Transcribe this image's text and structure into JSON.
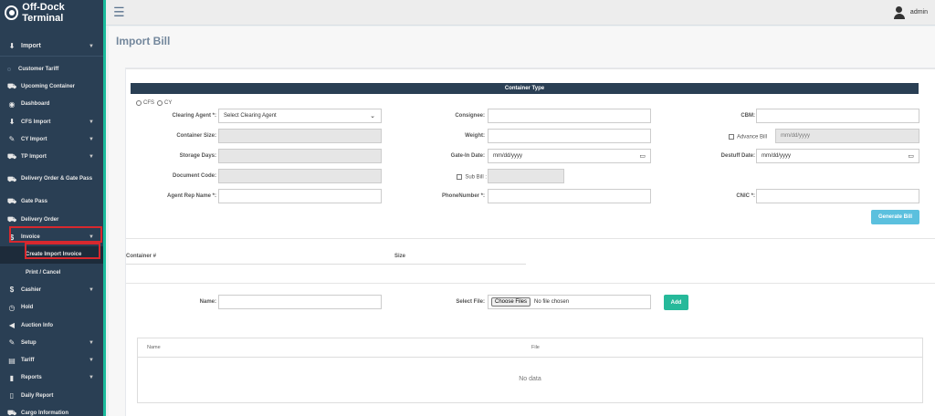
{
  "app": {
    "title": "Off-Dock Terminal"
  },
  "topbar": {
    "user": "admin"
  },
  "sidebar": {
    "top": {
      "label": "Import",
      "icon": "import-icon"
    },
    "items": [
      {
        "label": "Customer Tariff",
        "icon": "dot",
        "name": "customer-tariff"
      },
      {
        "label": "Upcoming Container",
        "icon": "bus-icon",
        "name": "upcoming-container"
      },
      {
        "label": "Dashboard",
        "icon": "dashboard-icon",
        "name": "dashboard"
      },
      {
        "label": "CFS Import",
        "icon": "import-icon",
        "name": "cfs-import",
        "chevron": true
      },
      {
        "label": "CY Import",
        "icon": "edit-icon",
        "name": "cy-import",
        "chevron": true
      },
      {
        "label": "TP Import",
        "icon": "truck-icon",
        "name": "tp-import",
        "chevron": true
      },
      {
        "label": "Delivery Order & Gate Pass",
        "icon": "truck-icon",
        "name": "delivery-order-gate-pass",
        "twoLine": true
      },
      {
        "label": "Gate Pass",
        "icon": "truck-icon",
        "name": "gate-pass"
      },
      {
        "label": "Delivery Order",
        "icon": "truck-icon",
        "name": "delivery-order"
      },
      {
        "label": "Invoice",
        "icon": "dollar-icon",
        "name": "invoice",
        "chevron": true
      },
      {
        "label": "Create Import Invoice",
        "sub": true,
        "active": true,
        "name": "create-import-invoice"
      },
      {
        "label": "Print / Cancel",
        "sub": true,
        "name": "print-cancel"
      },
      {
        "label": "Cashier",
        "icon": "dollar-icon",
        "name": "cashier",
        "chevron": true
      },
      {
        "label": "Hold",
        "icon": "clock-icon",
        "name": "hold"
      },
      {
        "label": "Auction Info",
        "icon": "bullhorn-icon",
        "name": "auction-info"
      },
      {
        "label": "Setup",
        "icon": "edit-icon",
        "name": "setup",
        "chevron": true
      },
      {
        "label": "Tariff",
        "icon": "table-icon",
        "name": "tariff",
        "chevron": true
      },
      {
        "label": "Reports",
        "icon": "file-icon",
        "name": "reports",
        "chevron": true
      },
      {
        "label": "Daily Report",
        "icon": "report-icon",
        "name": "daily-report"
      },
      {
        "label": "Cargo Information",
        "icon": "bus-icon",
        "name": "cargo-information"
      }
    ]
  },
  "page": {
    "title": "Import Bill"
  },
  "container_type": {
    "header": "Container Type",
    "options": [
      "CFS",
      "CY"
    ]
  },
  "form": {
    "clearing_agent": {
      "label": "Clearing Agent *:",
      "value": "Select Clearing Agent"
    },
    "consignee": {
      "label": "Consignee:",
      "value": ""
    },
    "cbm": {
      "label": "CBM:",
      "value": ""
    },
    "container_size": {
      "label": "Container Size:"
    },
    "weight": {
      "label": "Weight:",
      "value": ""
    },
    "advance_bill": {
      "label": "Advance Bill",
      "placeholder": "mm/dd/yyyy"
    },
    "storage_days": {
      "label": "Storage Days:"
    },
    "gate_in_date": {
      "label": "Gate-In Date:",
      "placeholder": "mm/dd/yyyy"
    },
    "destuff_date": {
      "label": "Destuff Date:",
      "placeholder": "mm/dd/yyyy"
    },
    "document_code": {
      "label": "Document Code:"
    },
    "sub_bill": {
      "label": "Sub Bill :"
    },
    "agent_rep_name": {
      "label": "Agent Rep Name *:",
      "value": ""
    },
    "phone_number": {
      "label": "PhoneNumber *:",
      "value": ""
    },
    "cnic": {
      "label": "CNIC *:",
      "value": ""
    },
    "generate_bill": "Generate Bill"
  },
  "container_list": {
    "col_container": "Container #",
    "col_size": "Size"
  },
  "attachments": {
    "name_label": "Name:",
    "file_label": "Select File:",
    "choose_btn": "Choose Files",
    "no_file": "No file chosen",
    "add_btn": "Add",
    "table": {
      "col_name": "Name",
      "col_file": "File",
      "empty": "No data"
    }
  }
}
